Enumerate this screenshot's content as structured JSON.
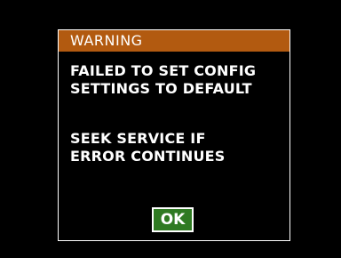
{
  "dialog": {
    "title": "WARNING",
    "message_1": [
      "FAILED TO SET CONFIG",
      "SETTINGS TO DEFAULT"
    ],
    "message_2": [
      "SEEK SERVICE IF",
      "ERROR CONTINUES"
    ],
    "ok_label": "OK"
  },
  "colors": {
    "background": "#000000",
    "title_bar": "#b25a10",
    "ok_button": "#2f7a22",
    "text": "#ffffff"
  }
}
